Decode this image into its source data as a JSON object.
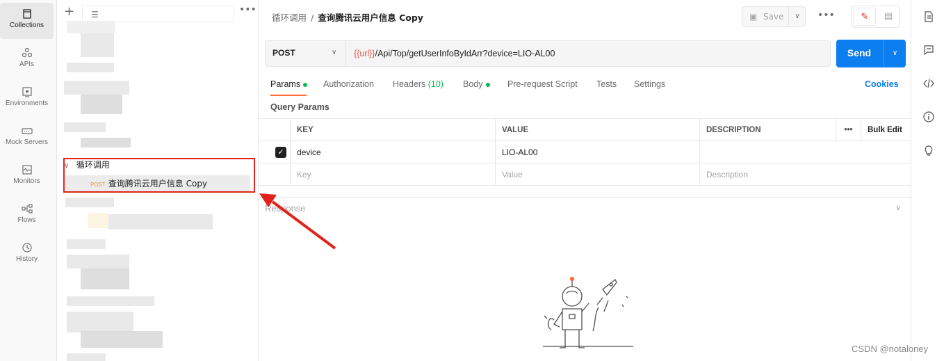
{
  "nav": {
    "items": [
      {
        "label": "Collections",
        "icon": "collections-icon",
        "active": true
      },
      {
        "label": "APIs",
        "icon": "apis-icon"
      },
      {
        "label": "Environments",
        "icon": "environments-icon"
      },
      {
        "label": "Mock Servers",
        "icon": "mock-servers-icon"
      },
      {
        "label": "Monitors",
        "icon": "monitors-icon"
      },
      {
        "label": "Flows",
        "icon": "flows-icon"
      },
      {
        "label": "History",
        "icon": "history-icon"
      }
    ]
  },
  "sidebar": {
    "folder_name": "循环调用",
    "request": {
      "method": "POST",
      "name": "查询腾讯云用户信息 Copy"
    }
  },
  "header": {
    "breadcrumb_parent": "循环调用",
    "breadcrumb_separator": "/",
    "breadcrumb_current": "查询腾讯云用户信息 Copy",
    "save_label": "Save"
  },
  "request": {
    "method": "POST",
    "url_variable": "{{url}}",
    "url_rest": "/Api/Top/getUserInfoByIdArr?device=LIO-AL00",
    "send_label": "Send"
  },
  "tabs": [
    {
      "label": "Params",
      "dot": true
    },
    {
      "label": "Authorization"
    },
    {
      "label": "Headers",
      "count": "(10)"
    },
    {
      "label": "Body",
      "dot": true
    },
    {
      "label": "Pre-request Script"
    },
    {
      "label": "Tests"
    },
    {
      "label": "Settings"
    }
  ],
  "cookies_label": "Cookies",
  "query_params": {
    "title": "Query Params",
    "headers": {
      "key": "KEY",
      "value": "VALUE",
      "description": "DESCRIPTION",
      "bulk_edit": "Bulk Edit"
    },
    "rows": [
      {
        "key": "device",
        "value": "LIO-AL00",
        "description": "",
        "checked": true
      }
    ],
    "placeholder": {
      "key": "Key",
      "value": "Value",
      "description": "Description"
    }
  },
  "response": {
    "title": "Response"
  },
  "watermark": "CSDN @notaloney",
  "colors": {
    "accent": "#0c7ef0",
    "highlight": "#e2231a",
    "variable": "#e2584a",
    "active_tab": "#ff6c37",
    "dot": "#0cbb52"
  }
}
